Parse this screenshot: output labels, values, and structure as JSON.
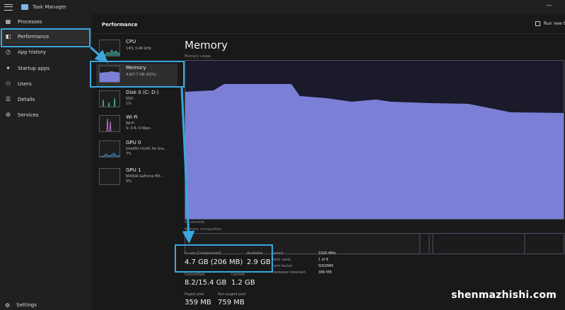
{
  "window": {
    "title": "Task Manager",
    "hamburger_icon": "hamburger-icon",
    "app_icon": "task-manager-icon"
  },
  "sidebar": {
    "items": [
      {
        "label": "Processes",
        "icon": "processes-icon",
        "glyph": "▦"
      },
      {
        "label": "Performance",
        "icon": "performance-icon",
        "glyph": "◧"
      },
      {
        "label": "App history",
        "icon": "app-history-icon",
        "glyph": "◷"
      },
      {
        "label": "Startup apps",
        "icon": "startup-icon",
        "glyph": "✦"
      },
      {
        "label": "Users",
        "icon": "users-icon",
        "glyph": "⚇"
      },
      {
        "label": "Details",
        "icon": "details-icon",
        "glyph": "☰"
      },
      {
        "label": "Services",
        "icon": "services-icon",
        "glyph": "⚙"
      }
    ],
    "settings_label": "Settings",
    "settings_icon": "⚙"
  },
  "header": {
    "title": "Performance",
    "run_task_label": "Run new t"
  },
  "resources": [
    {
      "name": "CPU",
      "sub1": "14% 3.46 GHz",
      "sub2": ""
    },
    {
      "name": "Memory",
      "sub1": "4.8/7.7 GB (62%)",
      "sub2": ""
    },
    {
      "name": "Disk 0 (C: D:)",
      "sub1": "SSD",
      "sub2": "1%"
    },
    {
      "name": "Wi-Fi",
      "sub1": "Wi-Fi",
      "sub2": "S: 0 R: 0 Kbps"
    },
    {
      "name": "GPU 0",
      "sub1": "Intel(R) Iris(R) Xe Gra...",
      "sub2": "7%"
    },
    {
      "name": "GPU 1",
      "sub1": "NVIDIA GeForce MX...",
      "sub2": "0%"
    }
  ],
  "detail": {
    "title": "Memory",
    "usage_label": "Memory usage",
    "seconds_label": "60 seconds",
    "composition_label": "Memory composition"
  },
  "memory_usage_fraction": 0.62,
  "stats": {
    "in_use_label": "In use (Compressed)",
    "in_use_value": "4.7 GB (206 MB)",
    "available_label": "Available",
    "available_value": "2.9 GB",
    "committed_label": "Committed",
    "committed_value": "8.2/15.4 GB",
    "cached_label": "Cached",
    "cached_value": "1.2 GB",
    "paged_label": "Paged pool",
    "paged_value": "359 MB",
    "nonpaged_label": "Non-paged pool",
    "nonpaged_value": "759 MB"
  },
  "specs": [
    {
      "key": "Speed:",
      "value": "3200 MHz"
    },
    {
      "key": "Slots used:",
      "value": "1 of 8"
    },
    {
      "key": "Form factor:",
      "value": "SODIMM"
    },
    {
      "key": "Hardware reserved:",
      "value": "386 MB"
    }
  ],
  "colors": {
    "accent": "#3aa7e0",
    "memory_fill": "#7b7fd6"
  },
  "watermark": "shenmazhishi.com"
}
